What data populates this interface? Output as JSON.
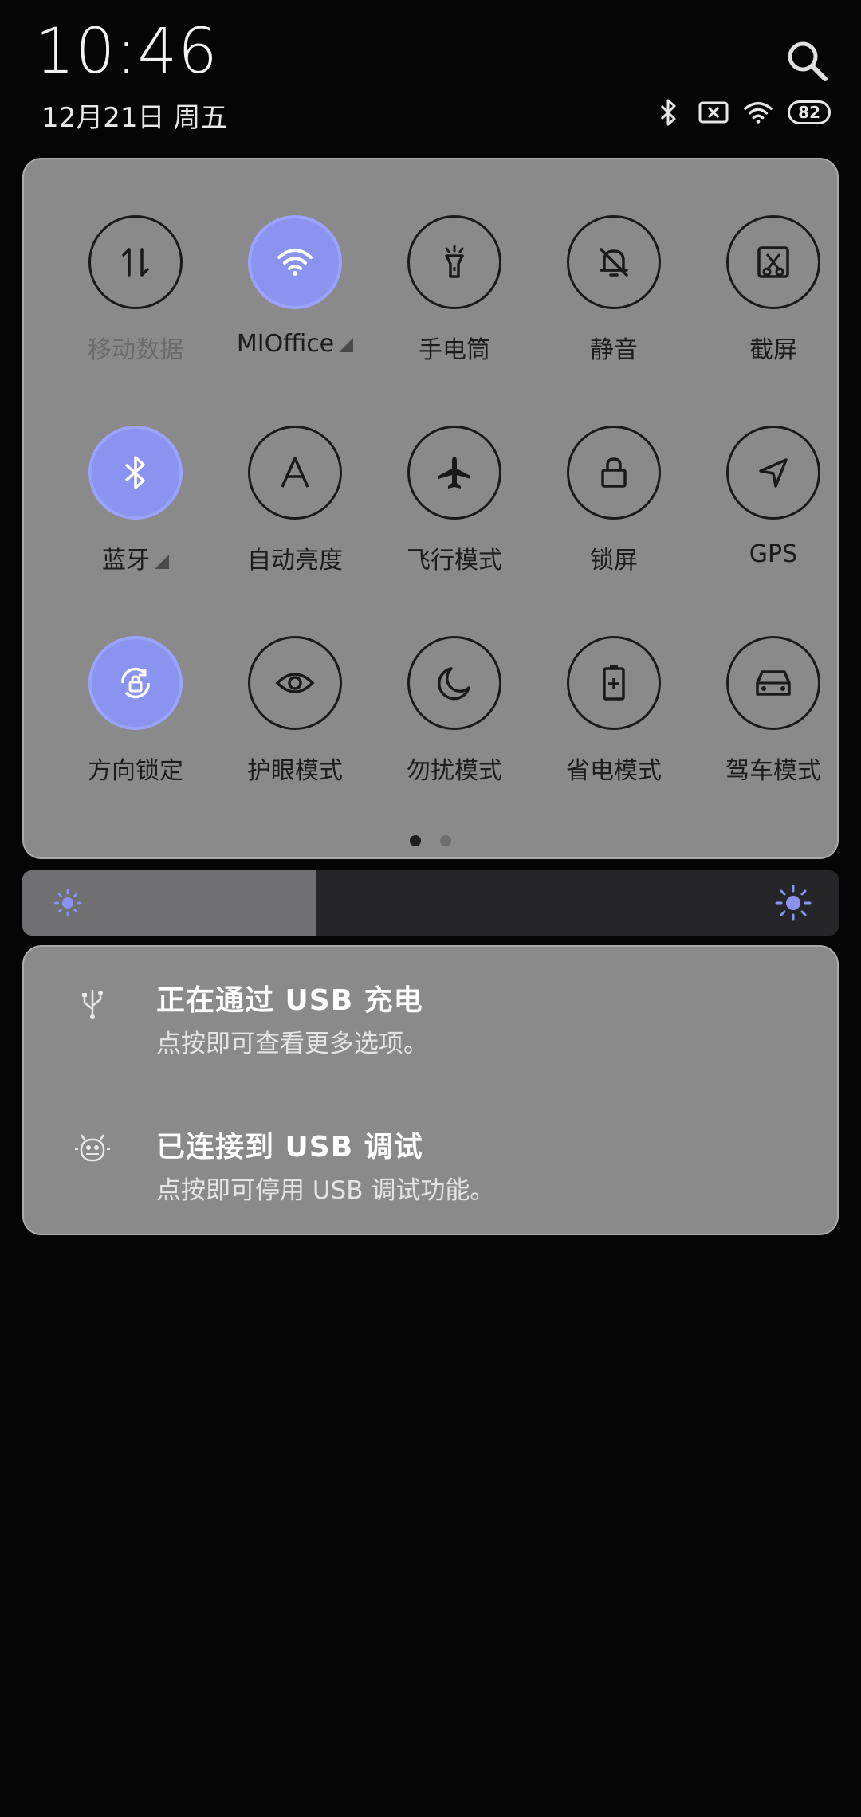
{
  "status": {
    "time": "10:46",
    "date": "12月21日 周五",
    "battery": "82",
    "icons": [
      "bluetooth-icon",
      "no-sim-icon",
      "wifi-icon",
      "battery-icon"
    ]
  },
  "quick_settings": {
    "tiles": [
      {
        "label": "移动数据",
        "icon": "mobile-data-icon",
        "active": false
      },
      {
        "label": "MIOffice",
        "icon": "wifi-icon",
        "active": true
      },
      {
        "label": "手电筒",
        "icon": "flashlight-icon",
        "active": false
      },
      {
        "label": "静音",
        "icon": "mute-icon",
        "active": false
      },
      {
        "label": "截屏",
        "icon": "screenshot-icon",
        "active": false
      },
      {
        "label": "蓝牙",
        "icon": "bluetooth-icon",
        "active": true
      },
      {
        "label": "自动亮度",
        "icon": "auto-brightness-icon",
        "active": false
      },
      {
        "label": "飞行模式",
        "icon": "airplane-icon",
        "active": false
      },
      {
        "label": "锁屏",
        "icon": "lock-icon",
        "active": false
      },
      {
        "label": "GPS",
        "icon": "location-icon",
        "active": false
      },
      {
        "label": "方向锁定",
        "icon": "rotation-lock-icon",
        "active": true
      },
      {
        "label": "护眼模式",
        "icon": "eye-icon",
        "active": false
      },
      {
        "label": "勿扰模式",
        "icon": "moon-icon",
        "active": false
      },
      {
        "label": "省电模式",
        "icon": "battery-saver-icon",
        "active": false
      },
      {
        "label": "驾车模式",
        "icon": "car-icon",
        "active": false
      }
    ],
    "pages": 2,
    "current_page": 1
  },
  "brightness": {
    "level_percent": 36
  },
  "notifications": [
    {
      "title": "正在通过 USB 充电",
      "subtitle": "点按即可查看更多选项。",
      "icon": "usb-icon"
    },
    {
      "title": "已连接到 USB 调试",
      "subtitle": "点按即可停用 USB 调试功能。",
      "icon": "android-debug-icon"
    }
  ],
  "colors": {
    "accent": "#8b93f0",
    "panel": "#8a8a8a",
    "background": "#050505"
  }
}
